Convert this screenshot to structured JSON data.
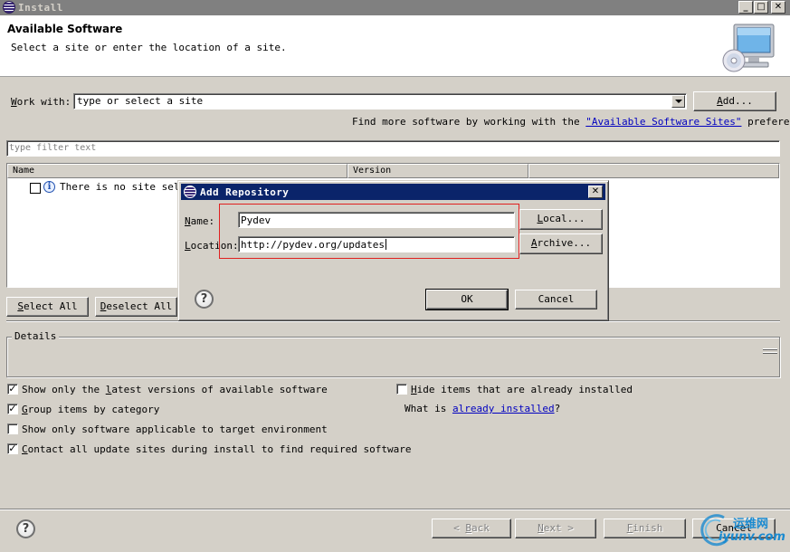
{
  "window": {
    "title": "Install",
    "minimize_glyph": "_",
    "maximize_glyph": "□",
    "close_glyph": "✕"
  },
  "banner": {
    "heading": "Available Software",
    "subtitle": "Select a site or enter the location of a site."
  },
  "work_with": {
    "label_mnemonic": "W",
    "label_rest": "ork with:",
    "value": "type or select a site",
    "add_mnemonic": "A",
    "add_rest": "dd..."
  },
  "more_software": {
    "prefix": "Find more software by working with the ",
    "link": "\"Available Software Sites\"",
    "suffix": " preferences."
  },
  "filter": {
    "placeholder": "type filter text"
  },
  "tree": {
    "columns": [
      "Name",
      "Version"
    ],
    "row_text": "There is no site selec"
  },
  "buttons": {
    "select_all_mnemonic": "S",
    "select_all_rest": "elect All",
    "deselect_all_mnemonic": "D",
    "deselect_all_rest": "eselect All"
  },
  "details": {
    "legend": "Details"
  },
  "options": {
    "latest_pre": "Show only the ",
    "latest_mn": "l",
    "latest_post": "atest versions of available software",
    "group_mn": "G",
    "group_post": "roup items by category",
    "applicable": "Show only software applicable to target environment",
    "contact_mn": "C",
    "contact_post": "ontact all update sites during install to find required software",
    "hide_mn": "H",
    "hide_post": "ide items that are already installed",
    "what_is_prefix": "What is ",
    "what_is_link": "already installed",
    "what_is_suffix": "?"
  },
  "checkbox_states": {
    "latest": true,
    "group": true,
    "applicable": false,
    "contact": true,
    "hide": false
  },
  "nav": {
    "back_glyph": "<",
    "back_mn": "B",
    "back_rest": "ack",
    "next_mn": "N",
    "next_rest": "ext",
    "next_glyph": ">",
    "finish_mn": "F",
    "finish_rest": "inish",
    "cancel": "Cancel"
  },
  "dialog": {
    "title": "Add Repository",
    "name_mn": "N",
    "name_rest": "ame:",
    "name_value": "Pydev",
    "location_mn": "L",
    "location_rest": "ocation:",
    "location_value": "http://pydev.org/updates",
    "local_mn": "L",
    "local_rest": "ocal...",
    "archive_mn": "A",
    "archive_rest": "rchive...",
    "ok": "OK",
    "cancel": "Cancel",
    "close_glyph": "✕"
  },
  "watermark": {
    "line1": "运维网",
    "line2": "iyunv.com"
  },
  "colors": {
    "dialog_title_bg": "#0a246a",
    "inactive_title_bg": "#808080",
    "highlight_border": "#e02020",
    "link": "#0000c0",
    "face": "#d4d0c8"
  },
  "icons": {
    "app": "eclipse-icon",
    "banner": "monitor-cd-icon",
    "info": "info-icon",
    "help": "help-icon",
    "sash": "sash-grip-icon"
  }
}
